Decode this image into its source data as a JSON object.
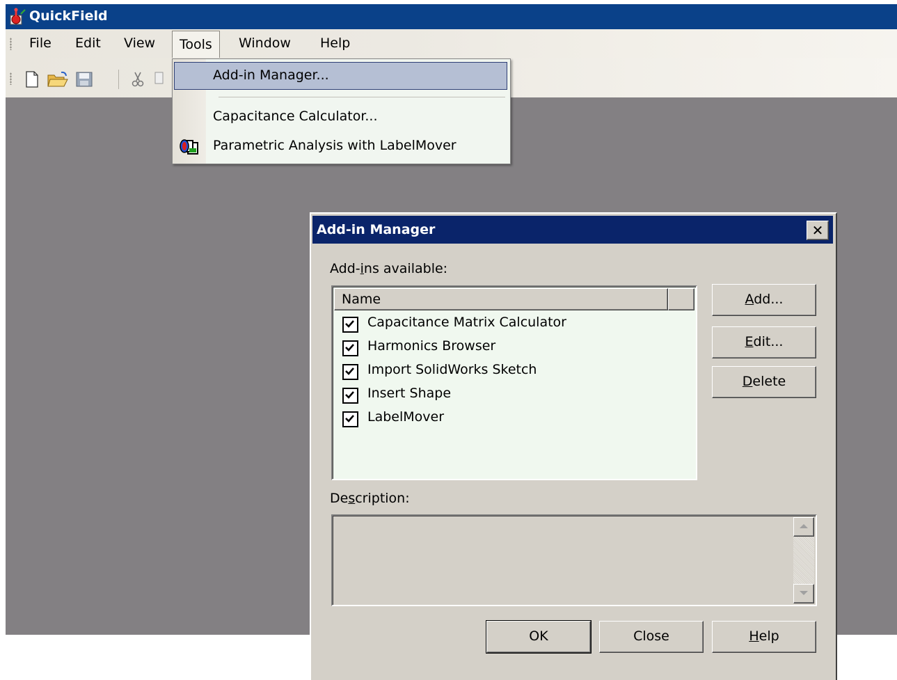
{
  "app": {
    "title": "QuickField",
    "menu": [
      "File",
      "Edit",
      "View",
      "Tools",
      "Window",
      "Help"
    ],
    "active_menu": "Tools",
    "toolbar_icons": [
      "new-file-icon",
      "open-folder-icon",
      "save-icon",
      "cut-icon",
      "copy-icon"
    ]
  },
  "tools_menu": {
    "items": [
      {
        "label": "Add-in Manager...",
        "highlighted": true
      },
      {
        "label": "Capacitance Calculator..."
      },
      {
        "label": "Parametric Analysis with LabelMover",
        "icon": "labelmover-icon"
      }
    ]
  },
  "dialog": {
    "title": "Add-in Manager",
    "close": "✕",
    "available_label": "Add-ins available:",
    "column_name": "Name",
    "addins": [
      {
        "name": "Capacitance Matrix Calculator",
        "checked": true
      },
      {
        "name": "Harmonics Browser",
        "checked": true
      },
      {
        "name": "Import SolidWorks Sketch",
        "checked": true
      },
      {
        "name": "Insert Shape",
        "checked": true
      },
      {
        "name": "LabelMover",
        "checked": true
      }
    ],
    "buttons": {
      "add": "Add...",
      "edit": "Edit...",
      "delete": "Delete",
      "ok": "OK",
      "close": "Close",
      "help": "Help"
    },
    "description_label": "Description:",
    "description_value": ""
  },
  "colors": {
    "titlebar": "#0a4189",
    "dialog_titlebar": "#0a246a",
    "workspace": "#838083",
    "list_bg": "#f0f8ef",
    "menu_highlight": "#b5bfd4"
  }
}
